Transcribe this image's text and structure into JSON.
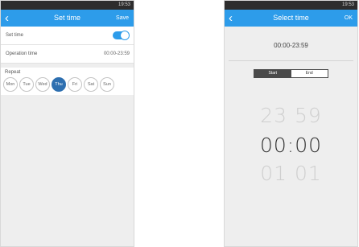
{
  "left": {
    "status": {
      "left": "",
      "right": "19:53"
    },
    "header": {
      "back": "‹",
      "title": "Set time",
      "action": "Save"
    },
    "set_time_label": "Set time",
    "operation_time_label": "Operation time",
    "operation_time_value": "00:00-23:59",
    "repeat_label": "Repeat",
    "days": [
      "Mon",
      "Tue",
      "Wed",
      "Thu",
      "Fri",
      "Sat",
      "Sun"
    ],
    "selected_day_index": 3,
    "toggle_on": true
  },
  "right": {
    "status": {
      "left": "",
      "right": "19:53"
    },
    "header": {
      "back": "‹",
      "title": "Select time",
      "action": "OK"
    },
    "range": "00:00-23:59",
    "segments": [
      "Start",
      "End"
    ],
    "active_segment": 0,
    "picker": {
      "prev": "23 59",
      "current": "00:00",
      "next": "01 01"
    }
  },
  "colors": {
    "accent": "#2d9cea",
    "selected_day": "#2d6fb0",
    "statusbar": "#2d2d2d"
  }
}
